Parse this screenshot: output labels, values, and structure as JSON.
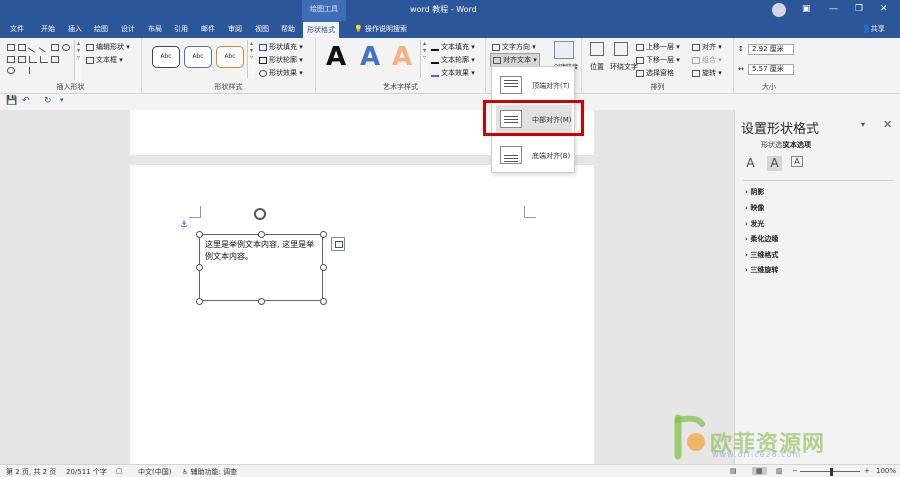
{
  "titlebar": {
    "context_tab": "绘图工具",
    "doc_title": "word 教程 - Word"
  },
  "tabs": {
    "items": [
      "文件",
      "开始",
      "插入",
      "绘图",
      "设计",
      "布局",
      "引用",
      "邮件",
      "审阅",
      "视图",
      "帮助",
      "形状格式"
    ],
    "search_label": "操作说明搜索",
    "share_label": "共享"
  },
  "ribbon": {
    "insert_shapes": {
      "label": "插入形状",
      "edit_shape": "编辑形状",
      "text_box": "文本框"
    },
    "shape_styles": {
      "label": "形状样式",
      "style_sample": "Abc",
      "fill": "形状填充",
      "outline": "形状轮廓",
      "effects": "形状效果"
    },
    "wordart": {
      "label": "艺术字样式",
      "sample": "A",
      "text_fill": "文本填充",
      "text_outline": "文本轮廓",
      "text_effects": "文本效果"
    },
    "text": {
      "direction": "文字方向",
      "align": "对齐文本",
      "create_link": "创建链接"
    },
    "arrange": {
      "label": "排列",
      "position": "位置",
      "wrap_text": "环绕文字",
      "bring_forward": "上移一层",
      "send_backward": "下移一层",
      "selection_pane": "选择窗格",
      "align": "对齐",
      "group": "组合",
      "rotate": "旋转"
    },
    "size": {
      "label": "大小",
      "height": "2.92 厘米",
      "width": "5.57 厘米"
    }
  },
  "dropdown": {
    "items": [
      "顶端对齐(T)",
      "中部对齐(M)",
      "底端对齐(B)"
    ]
  },
  "textbox": {
    "content": "这里是举例文本内容, 这里是举例文本内容。"
  },
  "pane": {
    "title": "设置形状格式",
    "tabs": [
      "形状选项",
      "文本选项"
    ],
    "sections": [
      "阴影",
      "映像",
      "发光",
      "柔化边缘",
      "三维格式",
      "三维旋转"
    ]
  },
  "status": {
    "page": "第 2 页, 共 2 页",
    "words": "20/511 个字",
    "language": "中文(中国)",
    "accessibility": "辅助功能: 调查",
    "zoom": "100%"
  },
  "watermark": {
    "brand": "欧菲资源网",
    "url": "www.office26.com"
  }
}
